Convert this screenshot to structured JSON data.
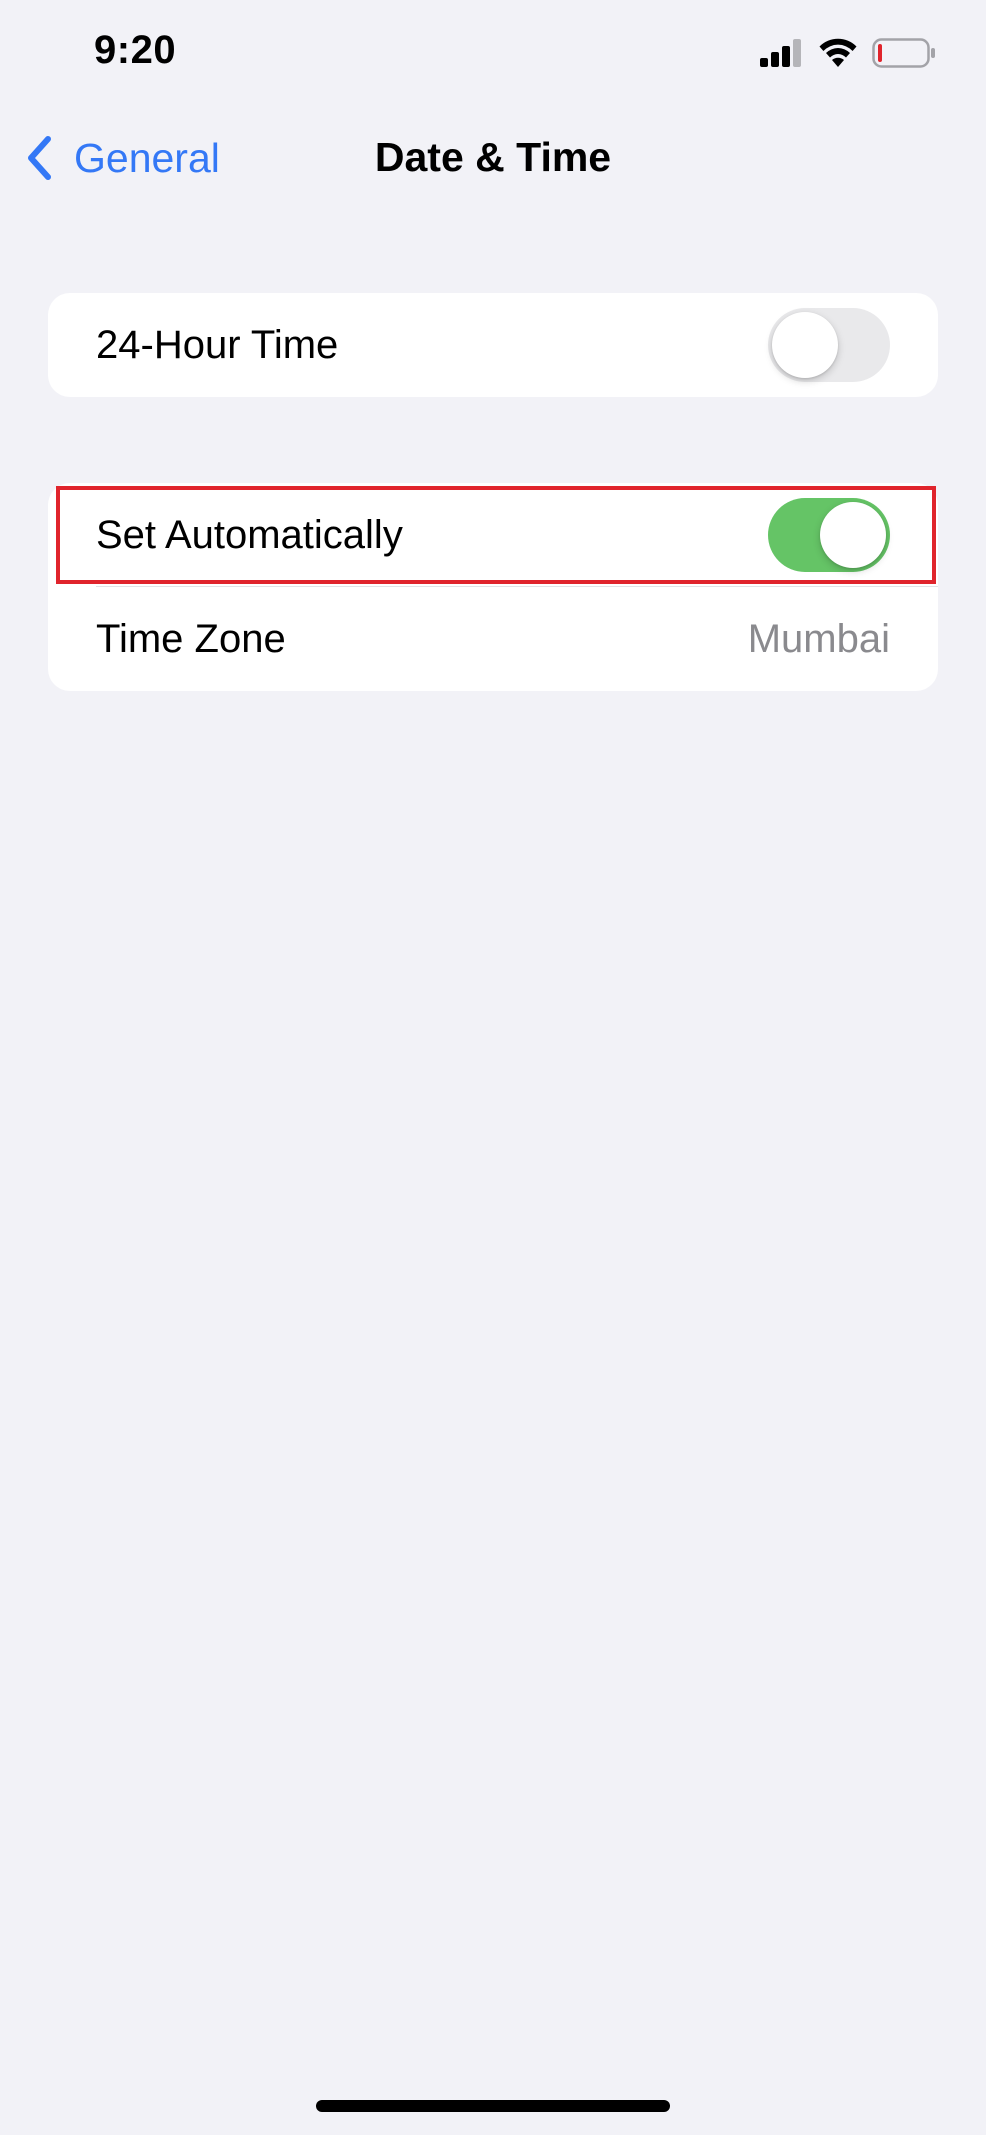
{
  "status_bar": {
    "time": "9:20",
    "icons": [
      "signal-icon",
      "wifi-icon",
      "battery-icon"
    ]
  },
  "nav": {
    "back_label": "General",
    "title": "Date & Time"
  },
  "settings": {
    "hour_24": {
      "label": "24-Hour Time",
      "enabled": false
    },
    "set_automatically": {
      "label": "Set Automatically",
      "enabled": true
    },
    "time_zone": {
      "label": "Time Zone",
      "value": "Mumbai"
    }
  },
  "colors": {
    "accent": "#3478f6",
    "toggle_on": "#65c466",
    "toggle_off": "#e9e9eb",
    "highlight": "#e0242c",
    "background": "#f2f2f7",
    "secondary_text": "#8a8a8e"
  }
}
